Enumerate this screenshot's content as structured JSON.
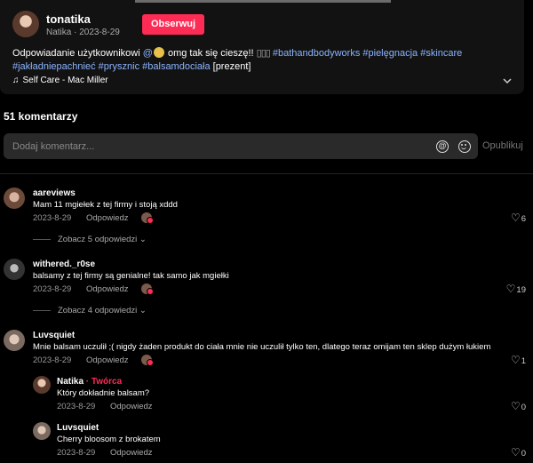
{
  "post": {
    "username": "tonatika",
    "subinfo": "Natika · 2023-8-29",
    "follow_label": "Obserwuj",
    "desc_plain1": "Odpowiadanie użytkownikowi ",
    "desc_mention": "@",
    "desc_plain2": " omg tak się cieszę!! ",
    "desc_boxes": "▯▯▯",
    "desc_tags_line1": "#bathandbodyworks #pielęgnacja #skincare",
    "desc_tags_line2": "#jakładniepachnieć #prysznic #balsamdociała",
    "desc_suffix": " [prezent]",
    "music_note": "♫",
    "music": "Self Care - Mac Miller",
    "expand_icon": "chevron-down-icon"
  },
  "comments_header": {
    "count": "51 komentarzy"
  },
  "comment_input": {
    "placeholder": "Dodaj komentarz...",
    "at_symbol": "@",
    "publish_label": "Opublikuj"
  },
  "comments": [
    {
      "author": "aareviews",
      "text": "Mam 11 mgiełek z tej firmy i stoją xddd",
      "date": "2023-8-29",
      "reply": "Odpowiedz",
      "likes": "6",
      "view_more": "Zobacz 5 odpowiedzi ⌄"
    },
    {
      "author": "withered._r0se",
      "text": "balsamy z tej firmy są genialne! tak samo jak mgiełki",
      "date": "2023-8-29",
      "reply": "Odpowiedz",
      "likes": "19",
      "view_more": "Zobacz 4 odpowiedzi ⌄"
    },
    {
      "author": "Luvsquiet",
      "text": "Mnie balsam uczulił ;( nigdy żaden produkt do ciała mnie nie uczulił tylko ten, dlatego teraz omijam ten sklep dużym łukiem",
      "date": "2023-8-29",
      "reply": "Odpowiedz",
      "likes": "1"
    }
  ],
  "replies": [
    {
      "author": "Natika",
      "badge": "· Twórca",
      "text": "Który dokładnie balsam?",
      "date": "2023-8-29",
      "reply": "Odpowiedz",
      "likes": "0"
    },
    {
      "author": "Luvsquiet",
      "text": "Cherry bloosom z brokatem",
      "date": "2023-8-29",
      "reply": "Odpowiedz",
      "likes": "0"
    }
  ],
  "heart_glyph": "♡",
  "colors": {
    "accent": "#fe2c55",
    "hashtag": "#8ab4ff",
    "background": "#000000",
    "card": "#121212"
  }
}
